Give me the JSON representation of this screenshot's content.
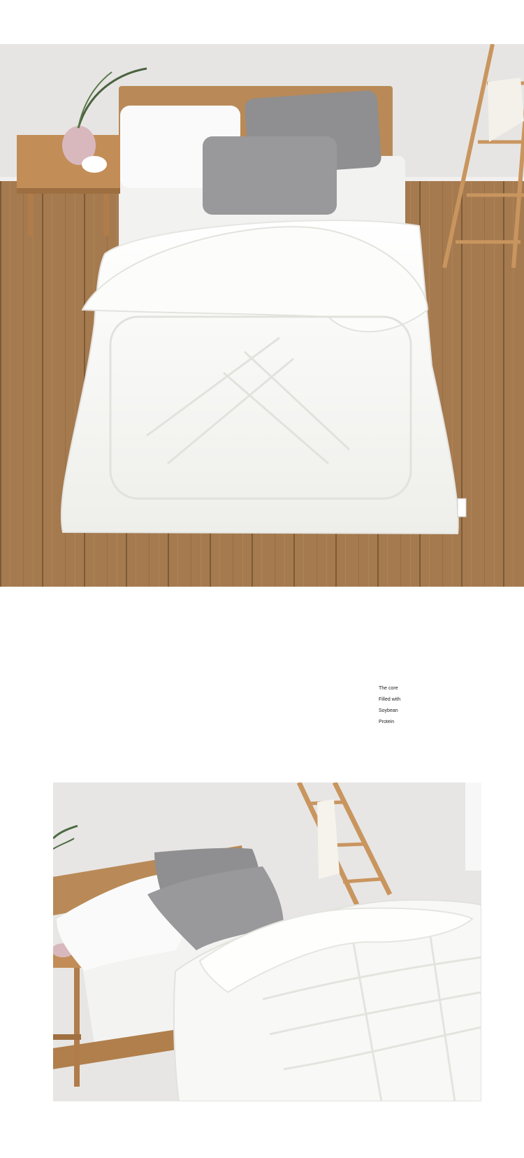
{
  "images": {
    "top": {
      "alt": "White quilted comforter on a wooden bed with grey and white pillows, top view"
    },
    "bottom": {
      "alt": "White comforter folded on a bed with pillows and a wooden ladder, side view"
    }
  },
  "caption": {
    "lines": [
      "The core",
      "Filled with",
      "Soybean",
      "Protein"
    ]
  },
  "colors": {
    "background": "#ffffff",
    "text": "#222222",
    "wood_floor": "#a57a4f",
    "wall": "#e6e5e3",
    "comforter": "#f7f7f5",
    "pillow_grey": "#8f8e90"
  }
}
